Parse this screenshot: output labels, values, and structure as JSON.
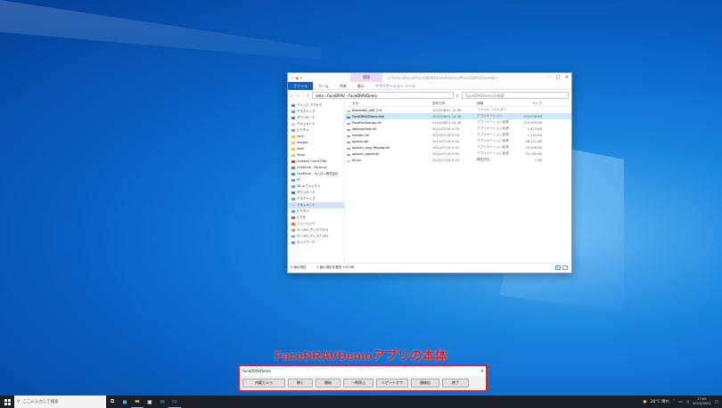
{
  "explorer": {
    "quick_access": "↶ ▣ ▾",
    "context_tab": "管理",
    "window_path": "C:¥Users¥omo¥FaceDRAVDemo¥release¥FaceDRAVDemo¥bin",
    "ribbon_tabs": [
      "ファイル",
      "ホーム",
      "共有",
      "表示",
      "アプリケーション ツール"
    ],
    "address": "omo › FaceDRAV › FaceDRAVDemo",
    "search_placeholder": "FaceDRAVDemoの検索",
    "nav_items": [
      {
        "label": "クイック アクセス",
        "sel": false,
        "color": "#3a8de0"
      },
      {
        "label": "デスクトップ",
        "sel": false,
        "color": "#5aa0e0"
      },
      {
        "label": "ダウンロード",
        "sel": false,
        "color": "#2f7fd8"
      },
      {
        "label": "ドキュメント",
        "sel": false,
        "color": "#c9cfd8"
      },
      {
        "label": "ピクチャ",
        "sel": false,
        "color": "#63a8e6"
      },
      {
        "label": "cecil",
        "sel": false,
        "color": "#e8c25a"
      },
      {
        "label": "images",
        "sel": false,
        "color": "#e8c25a"
      },
      {
        "label": "work",
        "sel": false,
        "color": "#e8c25a"
      },
      {
        "label": "Temp",
        "sel": false,
        "color": "#e8c25a"
      },
      {
        "label": "Creative Cloud Files",
        "sel": false,
        "color": "#d04040"
      },
      {
        "label": "OneDrive - Personal",
        "sel": false,
        "color": "#3a8de0"
      },
      {
        "label": "OneDrive - オムロン株式会社",
        "sel": false,
        "color": "#3a8de0"
      },
      {
        "label": "PC",
        "sel": false,
        "color": "#5aa0e0"
      },
      {
        "label": "3D オブジェクト",
        "sel": false,
        "color": "#63a8e6"
      },
      {
        "label": "ダウンロード",
        "sel": false,
        "color": "#2f7fd8"
      },
      {
        "label": "デスクトップ",
        "sel": false,
        "color": "#5aa0e0"
      },
      {
        "label": "ドキュメント",
        "sel": true,
        "color": "#c9cfd8"
      },
      {
        "label": "ピクチャ",
        "sel": false,
        "color": "#63a8e6"
      },
      {
        "label": "ビデオ",
        "sel": false,
        "color": "#7a62c8"
      },
      {
        "label": "ミュージック",
        "sel": false,
        "color": "#e0703a"
      },
      {
        "label": "ローカル ディスク (C:)",
        "sel": false,
        "color": "#9aa6b4"
      },
      {
        "label": "ローカル ディスク (D:)",
        "sel": false,
        "color": "#9aa6b4"
      },
      {
        "label": "ネットワーク",
        "sel": false,
        "color": "#5aa0e0"
      }
    ],
    "columns": {
      "name": "名前",
      "date": "更新日時",
      "type": "種類",
      "size": "サイズ"
    },
    "files": [
      {
        "name": "assembly_x64_0.4",
        "date": "2021/08/31 14:38",
        "type": "ファイル フォルダー",
        "size": "",
        "sel": false,
        "color": "#e8c25a"
      },
      {
        "name": "FaceDRAVDemo.exe",
        "date": "2021/08/31 14:38",
        "type": "アプリケーション",
        "size": "105,928 KB",
        "sel": true,
        "color": "#2f7fd8"
      },
      {
        "name": "FaceEstimation.dll",
        "date": "2021/08/31 14:38",
        "type": "アプリケーション拡張",
        "size": "215,559 KB",
        "sel": false,
        "color": "#9aa6b4"
      },
      {
        "name": "libiomp5md.dll",
        "date": "2021/07/18 9:33",
        "type": "アプリケーション拡張",
        "size": "1,623 KB",
        "sel": false,
        "color": "#9aa6b4"
      },
      {
        "name": "mkldnn.dll",
        "date": "2021/07/18 9:33",
        "type": "アプリケーション拡張",
        "size": "1,145 KB",
        "sel": false,
        "color": "#9aa6b4"
      },
      {
        "name": "opencv.dll",
        "date": "2021/07/18 9:33",
        "type": "アプリケーション拡張",
        "size": "58,221 KB",
        "sel": false,
        "color": "#9aa6b4"
      },
      {
        "name": "opencv_img_ffmpeg.dll",
        "date": "2021/07/18 9:33",
        "type": "アプリケーション拡張",
        "size": "20,308 KB",
        "sel": false,
        "color": "#9aa6b4"
      },
      {
        "name": "opencv_world.dll",
        "date": "2021/07/18 9:33",
        "type": "アプリケーション拡張",
        "size": "70,185 KB",
        "sel": false,
        "color": "#9aa6b4"
      },
      {
        "name": "Ini.ini",
        "date": "2021/07/18 9:33",
        "type": "構成設定",
        "size": "1 KB",
        "sel": false,
        "color": "#c9cfd8"
      }
    ],
    "status": {
      "count": "9 個の項目",
      "selected": "1 個の項目を選択 105 MB"
    }
  },
  "caption": "FaceDRAVDemoアプリの本体",
  "app": {
    "title": "FaceDRAVDemo",
    "buttons": [
      "内蔵カメラ",
      "開く",
      "開始",
      "一時停止",
      "リピートオフ",
      "顔検出",
      "終了"
    ]
  },
  "taskbar": {
    "search_placeholder": "ここに入力して検索",
    "weather": "28°C 晴れ",
    "time": "17:00",
    "date": "2021/09/01"
  }
}
